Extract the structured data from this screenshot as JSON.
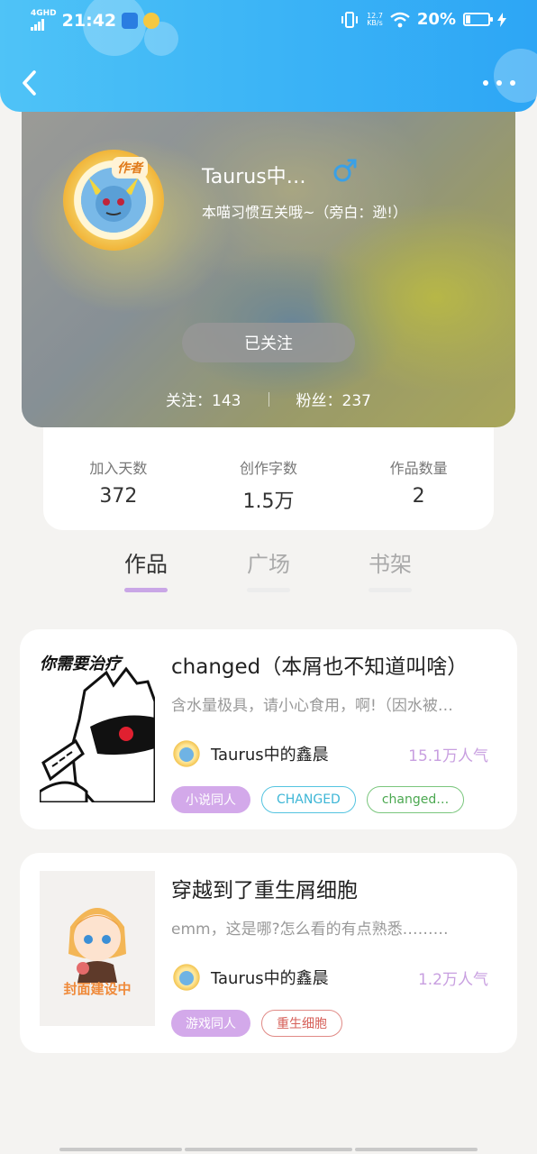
{
  "status_bar": {
    "network": "4GHD",
    "time": "21:42",
    "speed_value": "12.7",
    "speed_unit": "KB/s",
    "battery": "20%",
    "battery_level": 0.2
  },
  "profile": {
    "author_badge": "作者",
    "name": "Taurus中…",
    "bio": "本喵习惯互关哦~（旁白：逊!）",
    "follow_button": "已关注",
    "following": "关注：143",
    "followers": "粉丝：237"
  },
  "stats": [
    {
      "label": "加入天数",
      "value": "372"
    },
    {
      "label": "创作字数",
      "value": "1.5万"
    },
    {
      "label": "作品数量",
      "value": "2"
    }
  ],
  "tabs": [
    {
      "label": "作品",
      "active": true
    },
    {
      "label": "广场",
      "active": false
    },
    {
      "label": "书架",
      "active": false
    }
  ],
  "works": [
    {
      "cover_text": "你需要治疗",
      "title": "changed（本屑也不知道叫啥）",
      "desc": "含水量极具，请小心食用，啊!（因水被…",
      "author": "Taurus中的鑫晨",
      "popularity": "15.1万人气",
      "tags": [
        "小说同人",
        "CHANGED",
        "changed…"
      ]
    },
    {
      "cover_text": "封面建设中",
      "title": "穿越到了重生屑细胞",
      "desc": "emm，这是哪?怎么看的有点熟悉………",
      "author": "Taurus中的鑫晨",
      "popularity": "1.2万人气",
      "tags": [
        "游戏同人",
        "重生细胞"
      ]
    }
  ],
  "colors": {
    "header_blue": "#3fb7f6",
    "accent_purple": "#c9a6e6",
    "popularity_purple": "#c89fe0"
  }
}
